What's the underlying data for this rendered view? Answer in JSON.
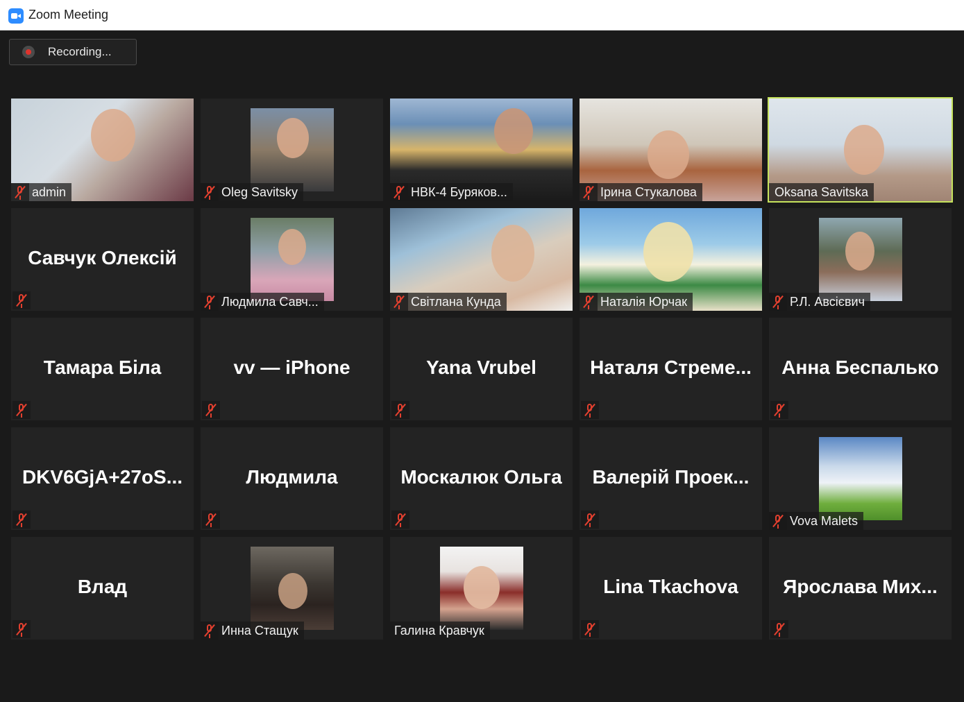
{
  "window": {
    "title": "Zoom Meeting"
  },
  "recording": {
    "label": "Recording..."
  },
  "participants": [
    {
      "name": "admin",
      "display": "photo",
      "muted": true
    },
    {
      "name": "Oleg Savitsky",
      "display": "photo",
      "muted": true
    },
    {
      "name": "НВК-4  Буряков...",
      "display": "photo",
      "muted": true
    },
    {
      "name": "Ірина Стукалова",
      "display": "photo",
      "muted": true
    },
    {
      "name": "Oksana Savitska",
      "display": "photo",
      "muted": false,
      "active_speaker": true
    },
    {
      "name": "Савчук Олексій",
      "display": "name",
      "muted": true
    },
    {
      "name": "Людмила Савч...",
      "display": "photo",
      "muted": true
    },
    {
      "name": "Світлана Кунда",
      "display": "photo",
      "muted": true
    },
    {
      "name": "Наталія Юрчак",
      "display": "photo",
      "muted": true
    },
    {
      "name": "Р.Л. Авсієвич",
      "display": "photo",
      "muted": true
    },
    {
      "name": "Тамара Біла",
      "display": "name",
      "muted": true
    },
    {
      "name": "vv — iPhone",
      "display": "name",
      "muted": true
    },
    {
      "name": "Yana Vrubel",
      "display": "name",
      "muted": true
    },
    {
      "name": "Наталя  Стреме...",
      "display": "name",
      "muted": true
    },
    {
      "name": "Анна Беспалько",
      "display": "name",
      "muted": true
    },
    {
      "name": "DKV6GjA+27oS...",
      "display": "name",
      "muted": true
    },
    {
      "name": "Людмила",
      "display": "name",
      "muted": true
    },
    {
      "name": "Москалюк Ольга",
      "display": "name",
      "muted": true
    },
    {
      "name": "Валерій  Проек...",
      "display": "name",
      "muted": true
    },
    {
      "name": "Vova Malets",
      "display": "photo",
      "muted": true
    },
    {
      "name": "Влад",
      "display": "name",
      "muted": true
    },
    {
      "name": "Инна Стащук",
      "display": "photo",
      "muted": true
    },
    {
      "name": "Галина Кравчук",
      "display": "photo",
      "muted": false
    },
    {
      "name": "Lina Tkachova",
      "display": "name",
      "muted": true
    },
    {
      "name": "Ярослава  Мих...",
      "display": "name",
      "muted": true
    }
  ],
  "colors": {
    "active_speaker_border": "#c6e35c",
    "muted_icon": "#e3402f",
    "background": "#1a1a1a"
  },
  "icons": {
    "app": "zoom-camera-icon",
    "recording": "record-dot-icon",
    "muted": "mic-muted-icon"
  }
}
